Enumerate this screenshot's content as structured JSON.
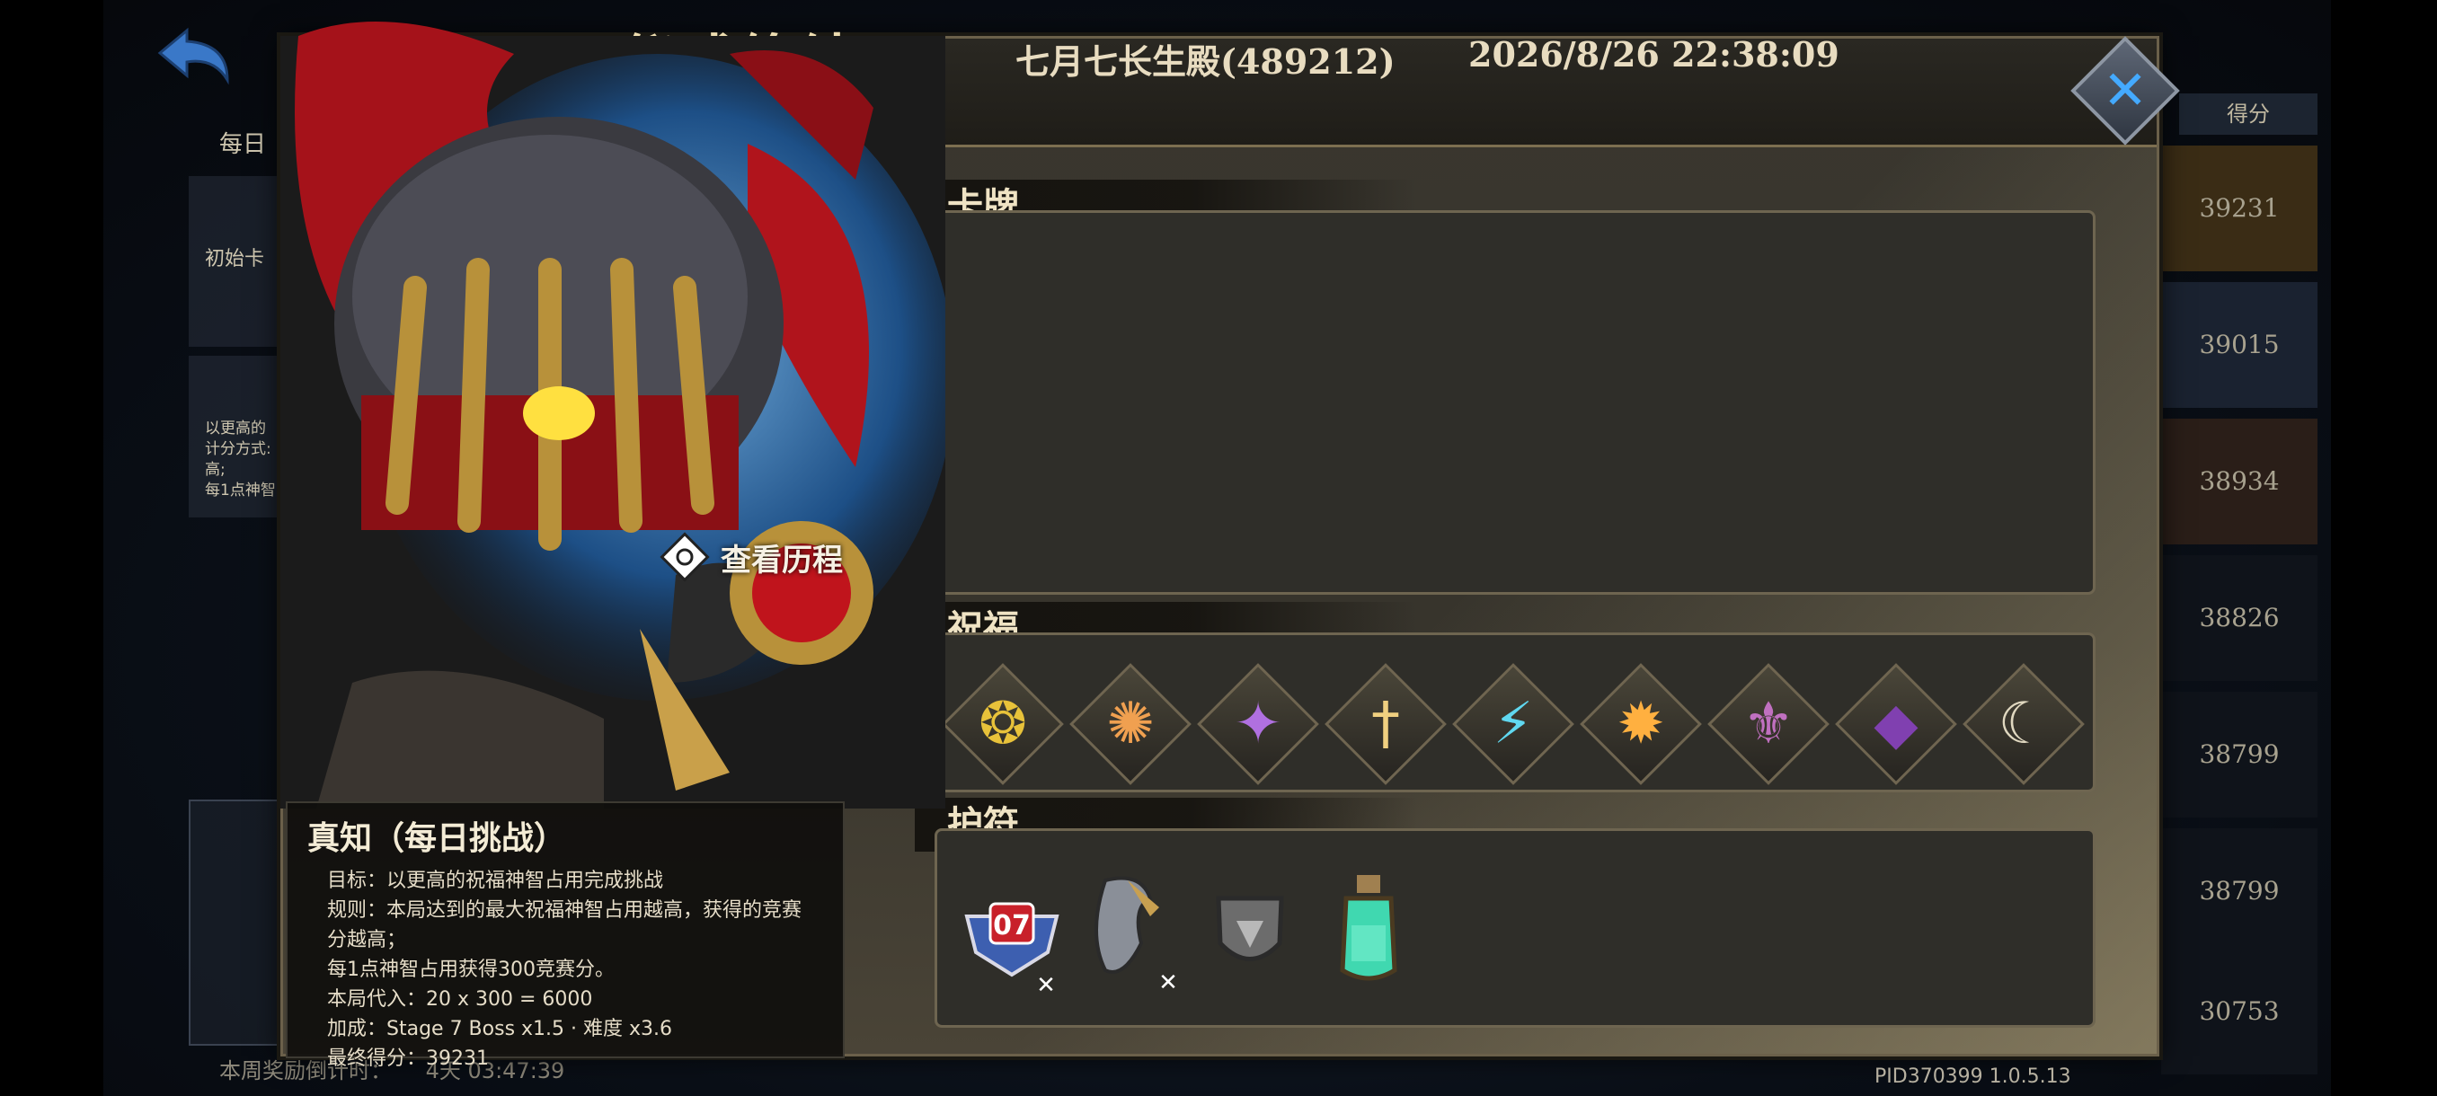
{
  "dialog": {
    "title": "仪式终结?",
    "server": "七月七长生殿(489212)",
    "datetime": "2026/8/26 22:38:09"
  },
  "sections": {
    "cards_label": "卡牌",
    "blessings_label": "祝福",
    "amulets_label": "护符"
  },
  "history_button": {
    "label": "查看历程"
  },
  "challenge_info": {
    "title": "真知（每日挑战）",
    "lines": [
      "目标：以更高的祝福神智占用完成挑战",
      "规则：本局达到的最大祝福神智占用越高，获得的竞赛",
      "分越高；",
      "每1点神智占用获得300竞赛分。",
      "本局代入：20 x 300 = 6000",
      "加成：Stage 7 Boss x1.5 · 难度 x3.6",
      "最终得分：39231"
    ]
  },
  "amulets": [
    {
      "name": "badge-07-icon",
      "text": "07"
    },
    {
      "name": "claw-blade-icon"
    },
    {
      "name": "shield-icon"
    },
    {
      "name": "green-potion-icon"
    }
  ],
  "blessings": [
    {
      "name": "gold-coin-swirl-icon",
      "color": "#e8c23a",
      "glyph": "❂"
    },
    {
      "name": "fire-swirl-icon",
      "color": "#f0a050",
      "glyph": "✺"
    },
    {
      "name": "purple-splash-icon",
      "color": "#b070e0",
      "glyph": "✦"
    },
    {
      "name": "golden-sword-icon",
      "color": "#f0d080",
      "glyph": "†"
    },
    {
      "name": "cyan-lightning-icon",
      "color": "#60d8f0",
      "glyph": "⚡"
    },
    {
      "name": "orange-purple-burst-icon",
      "color": "#ffb040",
      "glyph": "✹"
    },
    {
      "name": "purple-sigil-icon",
      "color": "#c070c0",
      "glyph": "⚜"
    },
    {
      "name": "dark-purple-crystal-icon",
      "color": "#8040b0",
      "glyph": "◆"
    },
    {
      "name": "crescent-spear-icon",
      "color": "#e0d8c0",
      "glyph": "☾"
    }
  ],
  "background": {
    "daily_label": "每日",
    "initial_label": "初始卡",
    "small_text_lines": [
      "以更高的",
      "计分方式:",
      "高;",
      "每1点神智"
    ],
    "bottom_text": "本周奖励倒计时：",
    "bottom_timer": "4天 03:47:39",
    "score_header": "得分",
    "scores": [
      "39231",
      "39015",
      "38934",
      "38826",
      "38799",
      "38799",
      "30753"
    ]
  },
  "version": "PID370399  1.0.5.13",
  "colors": {
    "accent_gold": "#ecdcb0",
    "close_blue": "#44aaff"
  }
}
